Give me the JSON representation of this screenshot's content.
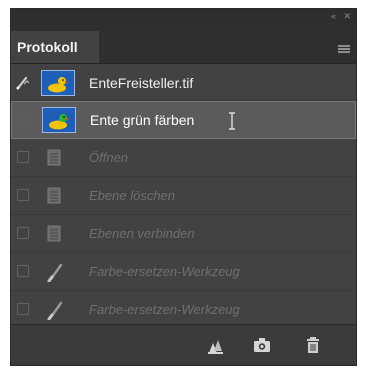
{
  "panel": {
    "tab_label": "Protokoll",
    "win_controls": [
      "«",
      "✕"
    ]
  },
  "history": {
    "snapshot": {
      "label": "EnteFreisteller.tif"
    },
    "items": [
      {
        "label": "Ente grün färben",
        "icon": "duck-thumbnail",
        "state": "selected"
      },
      {
        "label": "Öffnen",
        "icon": "document-icon",
        "state": "dimmed"
      },
      {
        "label": "Ebene löschen",
        "icon": "document-icon",
        "state": "dimmed"
      },
      {
        "label": "Ebenen verbinden",
        "icon": "document-icon",
        "state": "dimmed"
      },
      {
        "label": "Farbe-ersetzen-Werkzeug",
        "icon": "brush-icon",
        "state": "dimmed"
      },
      {
        "label": "Farbe-ersetzen-Werkzeug",
        "icon": "brush-icon",
        "state": "dimmed"
      }
    ]
  },
  "footer": {
    "buttons": [
      "new-document-from-state",
      "create-snapshot",
      "delete-state"
    ]
  },
  "colors": {
    "panel_bg": "#424242",
    "selected_row": "#5b5b5b",
    "thumbnail_bg": "#1d5eb8",
    "duck_yellow": "#f5c400",
    "duck_green": "#2fb32f"
  }
}
